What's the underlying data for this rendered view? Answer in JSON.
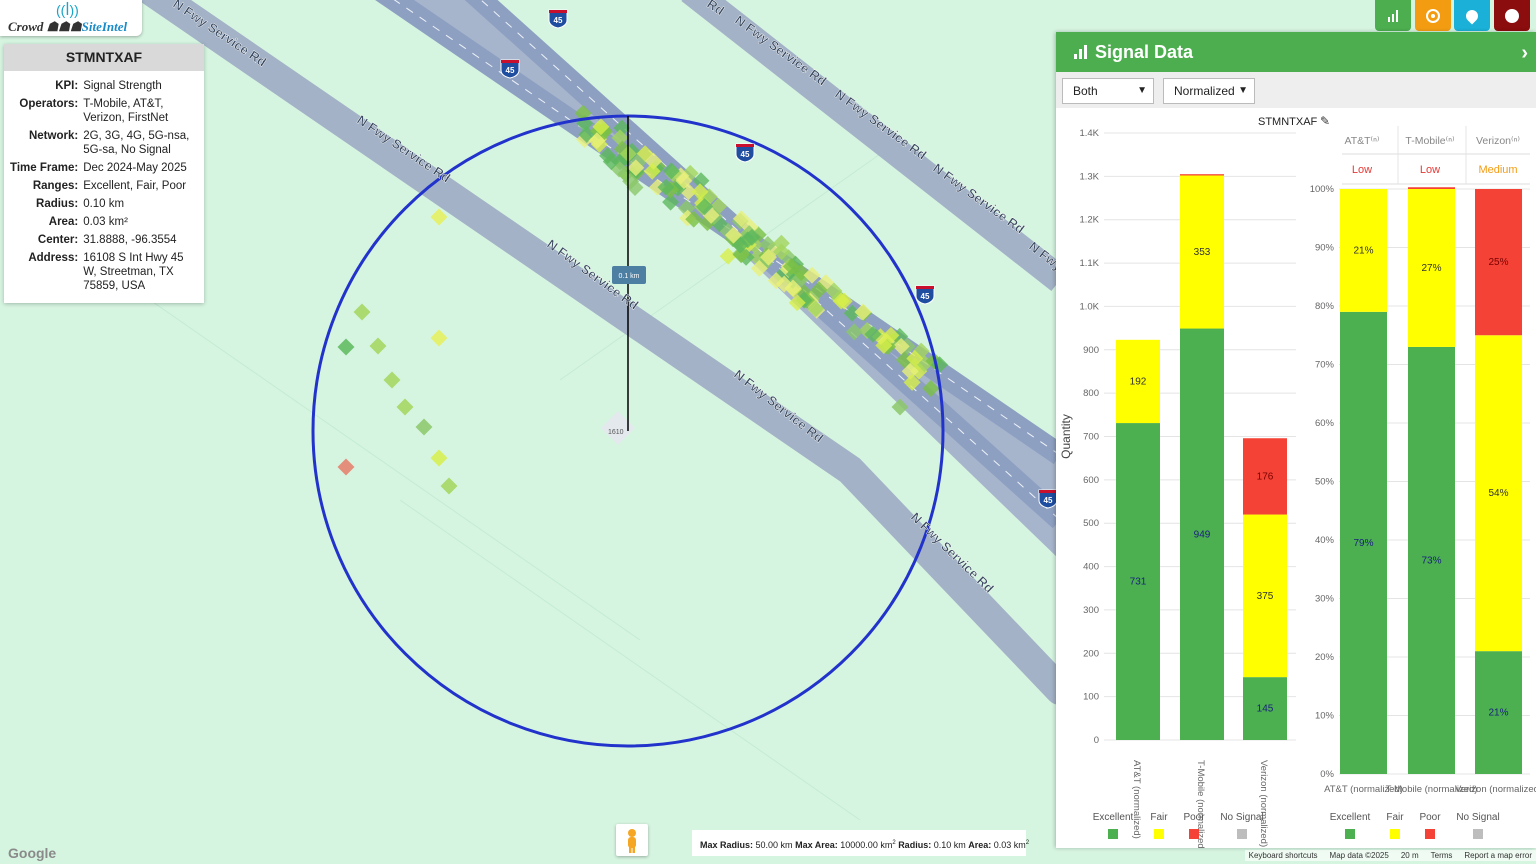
{
  "brand": {
    "name_part1": "Crowd",
    "name_part2": "SiteIntel"
  },
  "info": {
    "title": "STMNTXAF",
    "rows": [
      {
        "key": "KPI:",
        "value": "Signal Strength"
      },
      {
        "key": "Operators:",
        "value": "T-Mobile, AT&T, Verizon, FirstNet"
      },
      {
        "key": "Network:",
        "value": "2G, 3G, 4G, 5G-nsa, 5G-sa, No Signal"
      },
      {
        "key": "Time Frame:",
        "value": "Dec 2024-May 2025"
      },
      {
        "key": "Ranges:",
        "value": "Excellent, Fair, Poor"
      },
      {
        "key": "Radius:",
        "value": "0.10 km"
      },
      {
        "key": "Area:",
        "value": "0.03 km²"
      },
      {
        "key": "Center:",
        "value": "31.8888, -96.3554"
      },
      {
        "key": "Address:",
        "value": "16108 S Int Hwy 45 W, Streetman, TX 75859, USA"
      }
    ]
  },
  "toolbar": [
    {
      "icon": "chart-icon",
      "color": "#4cae4f"
    },
    {
      "icon": "target-icon",
      "color": "#f39c12"
    },
    {
      "icon": "pin-icon",
      "color": "#1ab0d8"
    },
    {
      "icon": "globe-pin-icon",
      "color": "#8b0d0d"
    }
  ],
  "map": {
    "road_labels": [
      "N Fwy Service Rd",
      "N Fwy Service Rd",
      "N Fwy Service Rd",
      "N Fwy Service Rd",
      "N Fwy Service Rd",
      "N Fwy Service Rd",
      "N Fwy Service Rd",
      "N Fwy",
      "N Fwy Service Rd",
      "Rd"
    ],
    "shields": [
      "45",
      "45",
      "45",
      "45",
      "45"
    ],
    "radius_label": "0.1 km",
    "center_label": "1610",
    "google": "Google",
    "pegman_icon": "pegman-icon",
    "attribution": [
      "Keyboard shortcuts",
      "Map data ©2025",
      "20 m",
      "Terms",
      "Report a map error"
    ],
    "limits": {
      "max_radius_label": "Max Radius:",
      "max_radius": "50.00 km",
      "max_area_label": "Max Area:",
      "max_area": "10000.00 km",
      "radius_label": "Radius:",
      "radius": "0.10 km",
      "area_label": "Area:",
      "area": "0.03 km",
      "sq": "2"
    }
  },
  "panel": {
    "title": "Signal Data",
    "select_mode": "Both",
    "select_scale": "Normalized",
    "site_name": "STMNTXAF",
    "ratings_header": [
      "AT&T⁽ⁿ⁾",
      "T-Mobile⁽ⁿ⁾",
      "Verizon⁽ⁿ⁾"
    ],
    "ratings": [
      {
        "label": "Low",
        "color": "#e53935"
      },
      {
        "label": "Low",
        "color": "#e53935"
      },
      {
        "label": "Medium",
        "color": "#f39c12"
      }
    ],
    "colors": {
      "excellent": "#4caf50",
      "fair": "#ffff00",
      "poor": "#f44336",
      "nosignal": "#bdbdbd"
    }
  },
  "chart_data": [
    {
      "type": "bar",
      "stacked": true,
      "categories": [
        "AT&T (normalized)",
        "T-Mobile (normalized)",
        "Verizon (normalized)"
      ],
      "series": [
        {
          "name": "Excellent",
          "values": [
            731,
            949,
            145
          ]
        },
        {
          "name": "Fair",
          "values": [
            192,
            353,
            375
          ]
        },
        {
          "name": "Poor",
          "values": [
            0,
            3,
            176
          ]
        },
        {
          "name": "No Signal",
          "values": [
            0,
            0,
            0
          ]
        }
      ],
      "ylabel": "Quantity",
      "ylim": [
        0,
        1400
      ],
      "yticks": [
        "0",
        "100",
        "200",
        "300",
        "400",
        "500",
        "600",
        "700",
        "800",
        "900",
        "1.0K",
        "1.1K",
        "1.2K",
        "1.3K",
        "1.4K"
      ],
      "legend": "bottom"
    },
    {
      "type": "bar",
      "stacked": true,
      "categories": [
        "AT&T (normalized)",
        "T-Mobile (normalized)",
        "Verizon (normalized)"
      ],
      "series": [
        {
          "name": "Excellent",
          "values": [
            79,
            73,
            21
          ]
        },
        {
          "name": "Fair",
          "values": [
            21,
            27,
            54
          ]
        },
        {
          "name": "Poor",
          "values": [
            0,
            0.3,
            25
          ]
        },
        {
          "name": "No Signal",
          "values": [
            0,
            0,
            0
          ]
        }
      ],
      "labels": [
        [
          "79%",
          "21%",
          ""
        ],
        [
          "73%",
          "27%",
          ""
        ],
        [
          "21%",
          "54%",
          "25%"
        ]
      ],
      "ylim": [
        0,
        100
      ],
      "yticks": [
        "0%",
        "10%",
        "20%",
        "30%",
        "40%",
        "50%",
        "60%",
        "70%",
        "80%",
        "90%",
        "100%"
      ],
      "legend": "bottom"
    }
  ]
}
